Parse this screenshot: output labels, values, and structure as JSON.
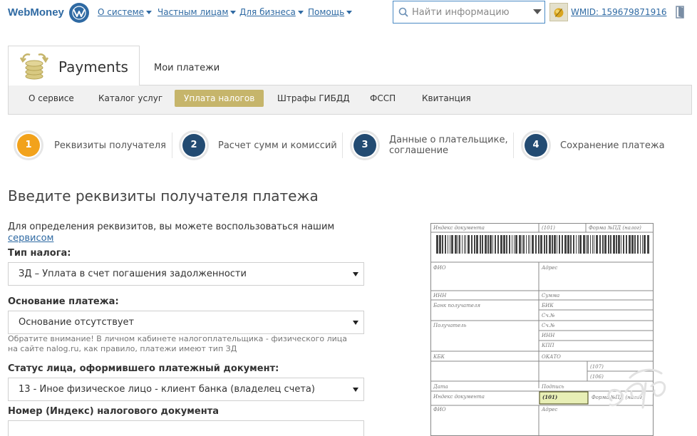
{
  "header": {
    "logo_text": "WebMoney",
    "nav": [
      {
        "label": "О системе"
      },
      {
        "label": "Частным лицам"
      },
      {
        "label": "Для бизнеса"
      },
      {
        "label": "Помощь"
      }
    ],
    "search_placeholder": "Найти информацию",
    "wmid": "WMID: 159679871916"
  },
  "payments": {
    "title": "Payments",
    "my_payments": "Мои платежи",
    "subnav": [
      {
        "label": "О сервисе"
      },
      {
        "label": "Каталог услуг"
      },
      {
        "label": "Уплата налогов",
        "active": true
      },
      {
        "label": "Штрафы ГИБДД"
      },
      {
        "label": "ФССП"
      },
      {
        "label": "Квитанция"
      }
    ]
  },
  "steps": [
    {
      "number": "1",
      "label": "Реквизиты получателя",
      "active": true
    },
    {
      "number": "2",
      "label": "Расчет сумм и комиссий"
    },
    {
      "number": "3",
      "label_line1": "Данные о плательщике,",
      "label_line2": "соглашение"
    },
    {
      "number": "4",
      "label": "Сохранение платежа"
    }
  ],
  "form": {
    "heading": "Введите реквизиты получателя платежа",
    "hint_text": "Для определения реквизитов, вы можете воспользоваться нашим",
    "hint_link": "сервисом",
    "tax_type_label": "Тип налога:",
    "tax_type_value": "ЗД – Уплата в счет погашения задолженности",
    "basis_label": "Основание платежа:",
    "basis_value": "Основание отсутствует",
    "note": "Обратите внимание! В личном кабинете налогоплательщика - физического лица на сайте nalog.ru, как правило, платежи имеют тип ЗД",
    "status_label": "Статус лица, оформившего платежный документ:",
    "status_value": "13 - Иное физическое лицо - клиент банка (владелец счета)",
    "doc_number_label": "Номер (Индекс) налогового документа"
  },
  "document": {
    "index_doc": "Индекс документа",
    "code_101": "(101)",
    "form_pd": "Форма №ПД (налог)",
    "fio": "ФИО",
    "address": "Адрес",
    "inn": "ИНН",
    "sum": "Сумма",
    "bank": "Банк получателя",
    "bik": "БИК",
    "acc": "Сч.№",
    "recipient": "Получатель",
    "kpp": "КПП",
    "kbk": "КБК",
    "okato": "ОКАТО",
    "code_107": "(107)",
    "code_106": "(106)",
    "date": "Дата",
    "signature": "Подпись"
  },
  "colors": {
    "brand_blue": "#2f6aa3",
    "step_active": "#f2a21b",
    "step_inactive": "#234b72",
    "tab_active": "#c6b56b",
    "highlight_box": "#e8efb6"
  }
}
